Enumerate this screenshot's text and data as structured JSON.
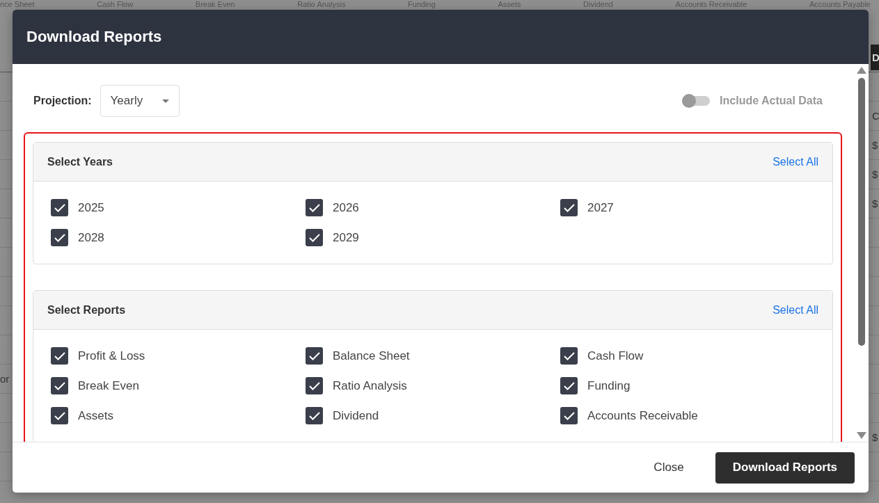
{
  "background": {
    "tabs": [
      "nce Sheet",
      "Cash Flow",
      "Break Even",
      "Ratio Analysis",
      "Funding",
      "Assets",
      "Dividend",
      "Accounts Receivable",
      "Accounts Payable"
    ],
    "rows": [
      {
        "kind": "header",
        "right": "D"
      },
      {
        "kind": "cell"
      },
      {
        "kind": "cell",
        "right": "C"
      },
      {
        "kind": "cell",
        "right": "$"
      },
      {
        "kind": "cell",
        "right": "$"
      },
      {
        "kind": "cell",
        "right": "$"
      },
      {
        "kind": "cell"
      },
      {
        "kind": "cell"
      },
      {
        "kind": "cell"
      },
      {
        "kind": "cell"
      },
      {
        "kind": "cell"
      },
      {
        "kind": "cell",
        "left": "or"
      },
      {
        "kind": "cell"
      },
      {
        "kind": "cell",
        "right": "$"
      },
      {
        "kind": "cell"
      }
    ]
  },
  "dialog": {
    "title": "Download Reports",
    "projection": {
      "label": "Projection:",
      "value": "Yearly"
    },
    "include_actual": {
      "label": "Include Actual Data",
      "on": false
    },
    "sections": [
      {
        "title": "Select Years",
        "action": "Select All",
        "options": [
          {
            "label": "2025",
            "checked": true
          },
          {
            "label": "2026",
            "checked": true
          },
          {
            "label": "2027",
            "checked": true
          },
          {
            "label": "2028",
            "checked": true
          },
          {
            "label": "2029",
            "checked": true
          }
        ]
      },
      {
        "title": "Select Reports",
        "action": "Select All",
        "options": [
          {
            "label": "Profit & Loss",
            "checked": true
          },
          {
            "label": "Balance Sheet",
            "checked": true
          },
          {
            "label": "Cash Flow",
            "checked": true
          },
          {
            "label": "Break Even",
            "checked": true
          },
          {
            "label": "Ratio Analysis",
            "checked": true
          },
          {
            "label": "Funding",
            "checked": true
          },
          {
            "label": "Assets",
            "checked": true
          },
          {
            "label": "Dividend",
            "checked": true
          },
          {
            "label": "Accounts Receivable",
            "checked": true
          }
        ]
      }
    ],
    "buttons": [
      {
        "label": "Close",
        "kind": "text"
      },
      {
        "label": "Download Reports",
        "kind": "primary"
      }
    ]
  }
}
